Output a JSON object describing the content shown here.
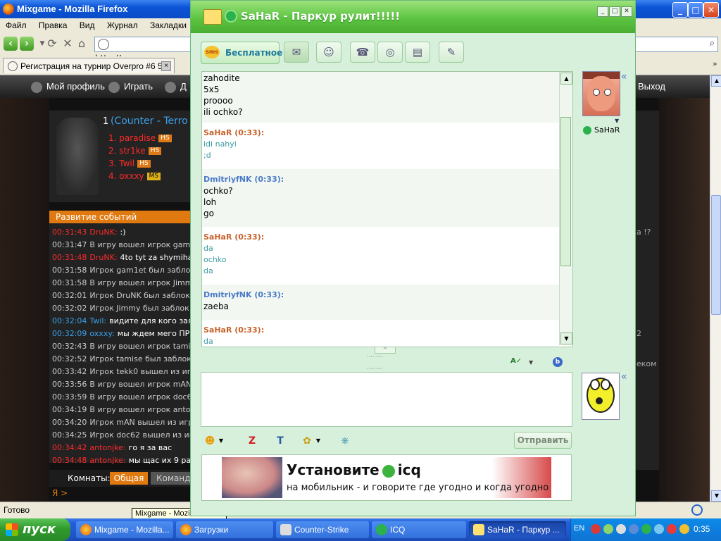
{
  "firefox": {
    "title": "Mixgame - Mozilla Firefox",
    "menu": [
      "Файл",
      "Правка",
      "Вид",
      "Журнал",
      "Закладки",
      "И"
    ],
    "url": "http://www.overpro.r",
    "tab_label": "Регистрация на турнир Overpro #6 5...",
    "status": "Готово",
    "tooltip": "Mixgame - Mozilla Firefox"
  },
  "site": {
    "nav": {
      "profile": "Мой профиль",
      "play": "Играть",
      "partial": "Д",
      "logout": "Выход"
    },
    "team_number": "1",
    "team_name": "(Counter - Terro",
    "players": [
      {
        "name": "1. paradise",
        "badge": "HS"
      },
      {
        "name": "2. str1ke",
        "badge": "HS"
      },
      {
        "name": "3. Twil",
        "badge": "HS"
      },
      {
        "name": "4. oxxxy",
        "badge": "MS"
      }
    ],
    "events_title": "Развитие событий",
    "log": [
      {
        "time": "00:31:43",
        "nick": "DruNK:",
        "text": ":)",
        "kind": "red"
      },
      {
        "time": "00:31:47",
        "nick": "",
        "text": "В игру вошел игрок gam1",
        "kind": "sys"
      },
      {
        "time": "00:31:48",
        "nick": "DruNK:",
        "text": "4to tyt za shymiha",
        "kind": "red"
      },
      {
        "time": "00:31:58",
        "nick": "",
        "text": "Игрок gam1et был заблок",
        "kind": "sys"
      },
      {
        "time": "00:31:58",
        "nick": "",
        "text": "В игру вошел игрок Jimm",
        "kind": "sys"
      },
      {
        "time": "00:32:01",
        "nick": "",
        "text": "Игрок DruNK был заблок",
        "kind": "sys"
      },
      {
        "time": "00:32:02",
        "nick": "",
        "text": "Игрок Jimmy был заблок",
        "kind": "sys"
      },
      {
        "time": "00:32:04",
        "nick": "Twil:",
        "text": "видите для кого зая",
        "kind": "blue"
      },
      {
        "time": "00:32:09",
        "nick": "oxxxy:",
        "text": "мы ждем мего ПР",
        "kind": "blue"
      },
      {
        "time": "00:32:43",
        "nick": "",
        "text": "В игру вошел игрок tamis",
        "kind": "sys"
      },
      {
        "time": "00:32:52",
        "nick": "",
        "text": "Игрок tamise был заблок",
        "kind": "sys"
      },
      {
        "time": "00:33:42",
        "nick": "",
        "text": "Игрок tekk0 вышел из игр",
        "kind": "sys"
      },
      {
        "time": "00:33:56",
        "nick": "",
        "text": "В игру вошел игрок mAN",
        "kind": "sys"
      },
      {
        "time": "00:33:59",
        "nick": "",
        "text": "В игру вошел игрок doc6",
        "kind": "sys"
      },
      {
        "time": "00:34:19",
        "nick": "",
        "text": "В игру вошел игрок anton",
        "kind": "sys"
      },
      {
        "time": "00:34:20",
        "nick": "",
        "text": "Игрок mAN вышел из игр",
        "kind": "sys"
      },
      {
        "time": "00:34:25",
        "nick": "",
        "text": "Игрок doc62 вышел из иг",
        "kind": "sys"
      },
      {
        "time": "00:34:42",
        "nick": "antonjke:",
        "text": "го я за вас",
        "kind": "red"
      },
      {
        "time": "00:34:48",
        "nick": "antonjke:",
        "text": "мы щас их 9 ра",
        "kind": "red"
      }
    ],
    "rooms_label": "Комнаты:",
    "room_general": "Общая",
    "room_cmd": "Команд",
    "me_prompt": "Я >",
    "right_fragments": [
      "a !?",
      "2",
      "еком"
    ]
  },
  "icq": {
    "title": "SaHaR - Паркур рулит!!!!!",
    "sms_label": "Бесплатное",
    "sms_icon_text": "sms",
    "contact_name": "SaHaR",
    "send_label": "Отправить",
    "messages": [
      {
        "author": "",
        "lines": [
          "zahodite",
          "5x5",
          "proooo",
          "ili ochko?"
        ],
        "kind": "self"
      },
      {
        "author": "SaHaR (0:33):",
        "lines": [
          "idi nahyi",
          ";d"
        ],
        "kind": "peer"
      },
      {
        "author": "DmitriyfNK (0:33):",
        "lines": [
          "ochko?",
          "loh",
          "go"
        ],
        "kind": "self"
      },
      {
        "author": "SaHaR (0:33):",
        "lines": [
          "da",
          "ochko",
          "da"
        ],
        "kind": "peer"
      },
      {
        "author": "DmitriyfNK (0:33):",
        "lines": [
          "zaeba"
        ],
        "kind": "self"
      },
      {
        "author": "SaHaR (0:33):",
        "lines": [
          "da"
        ],
        "kind": "peer"
      }
    ],
    "ad": {
      "line1_a": "Установите",
      "line1_b": "icq",
      "line2": "на мобильник - и говорите где угодно и когда угодно"
    }
  },
  "taskbar": {
    "start": "пуск",
    "tasks": [
      "Mixgame - Mozilla...",
      "Загрузки",
      "Counter-Strike",
      "ICQ",
      "SaHaR - Паркур ..."
    ],
    "lang": "EN",
    "clock": "0:35"
  },
  "colors": {
    "peer_author": "#c8622a",
    "peer_text": "#3a9aa0",
    "self_author": "#4a7ac8",
    "self_text": "#000000",
    "log_red": "#ff2a2a",
    "log_blue": "#3aa0e8",
    "log_sys": "#cccccc"
  }
}
